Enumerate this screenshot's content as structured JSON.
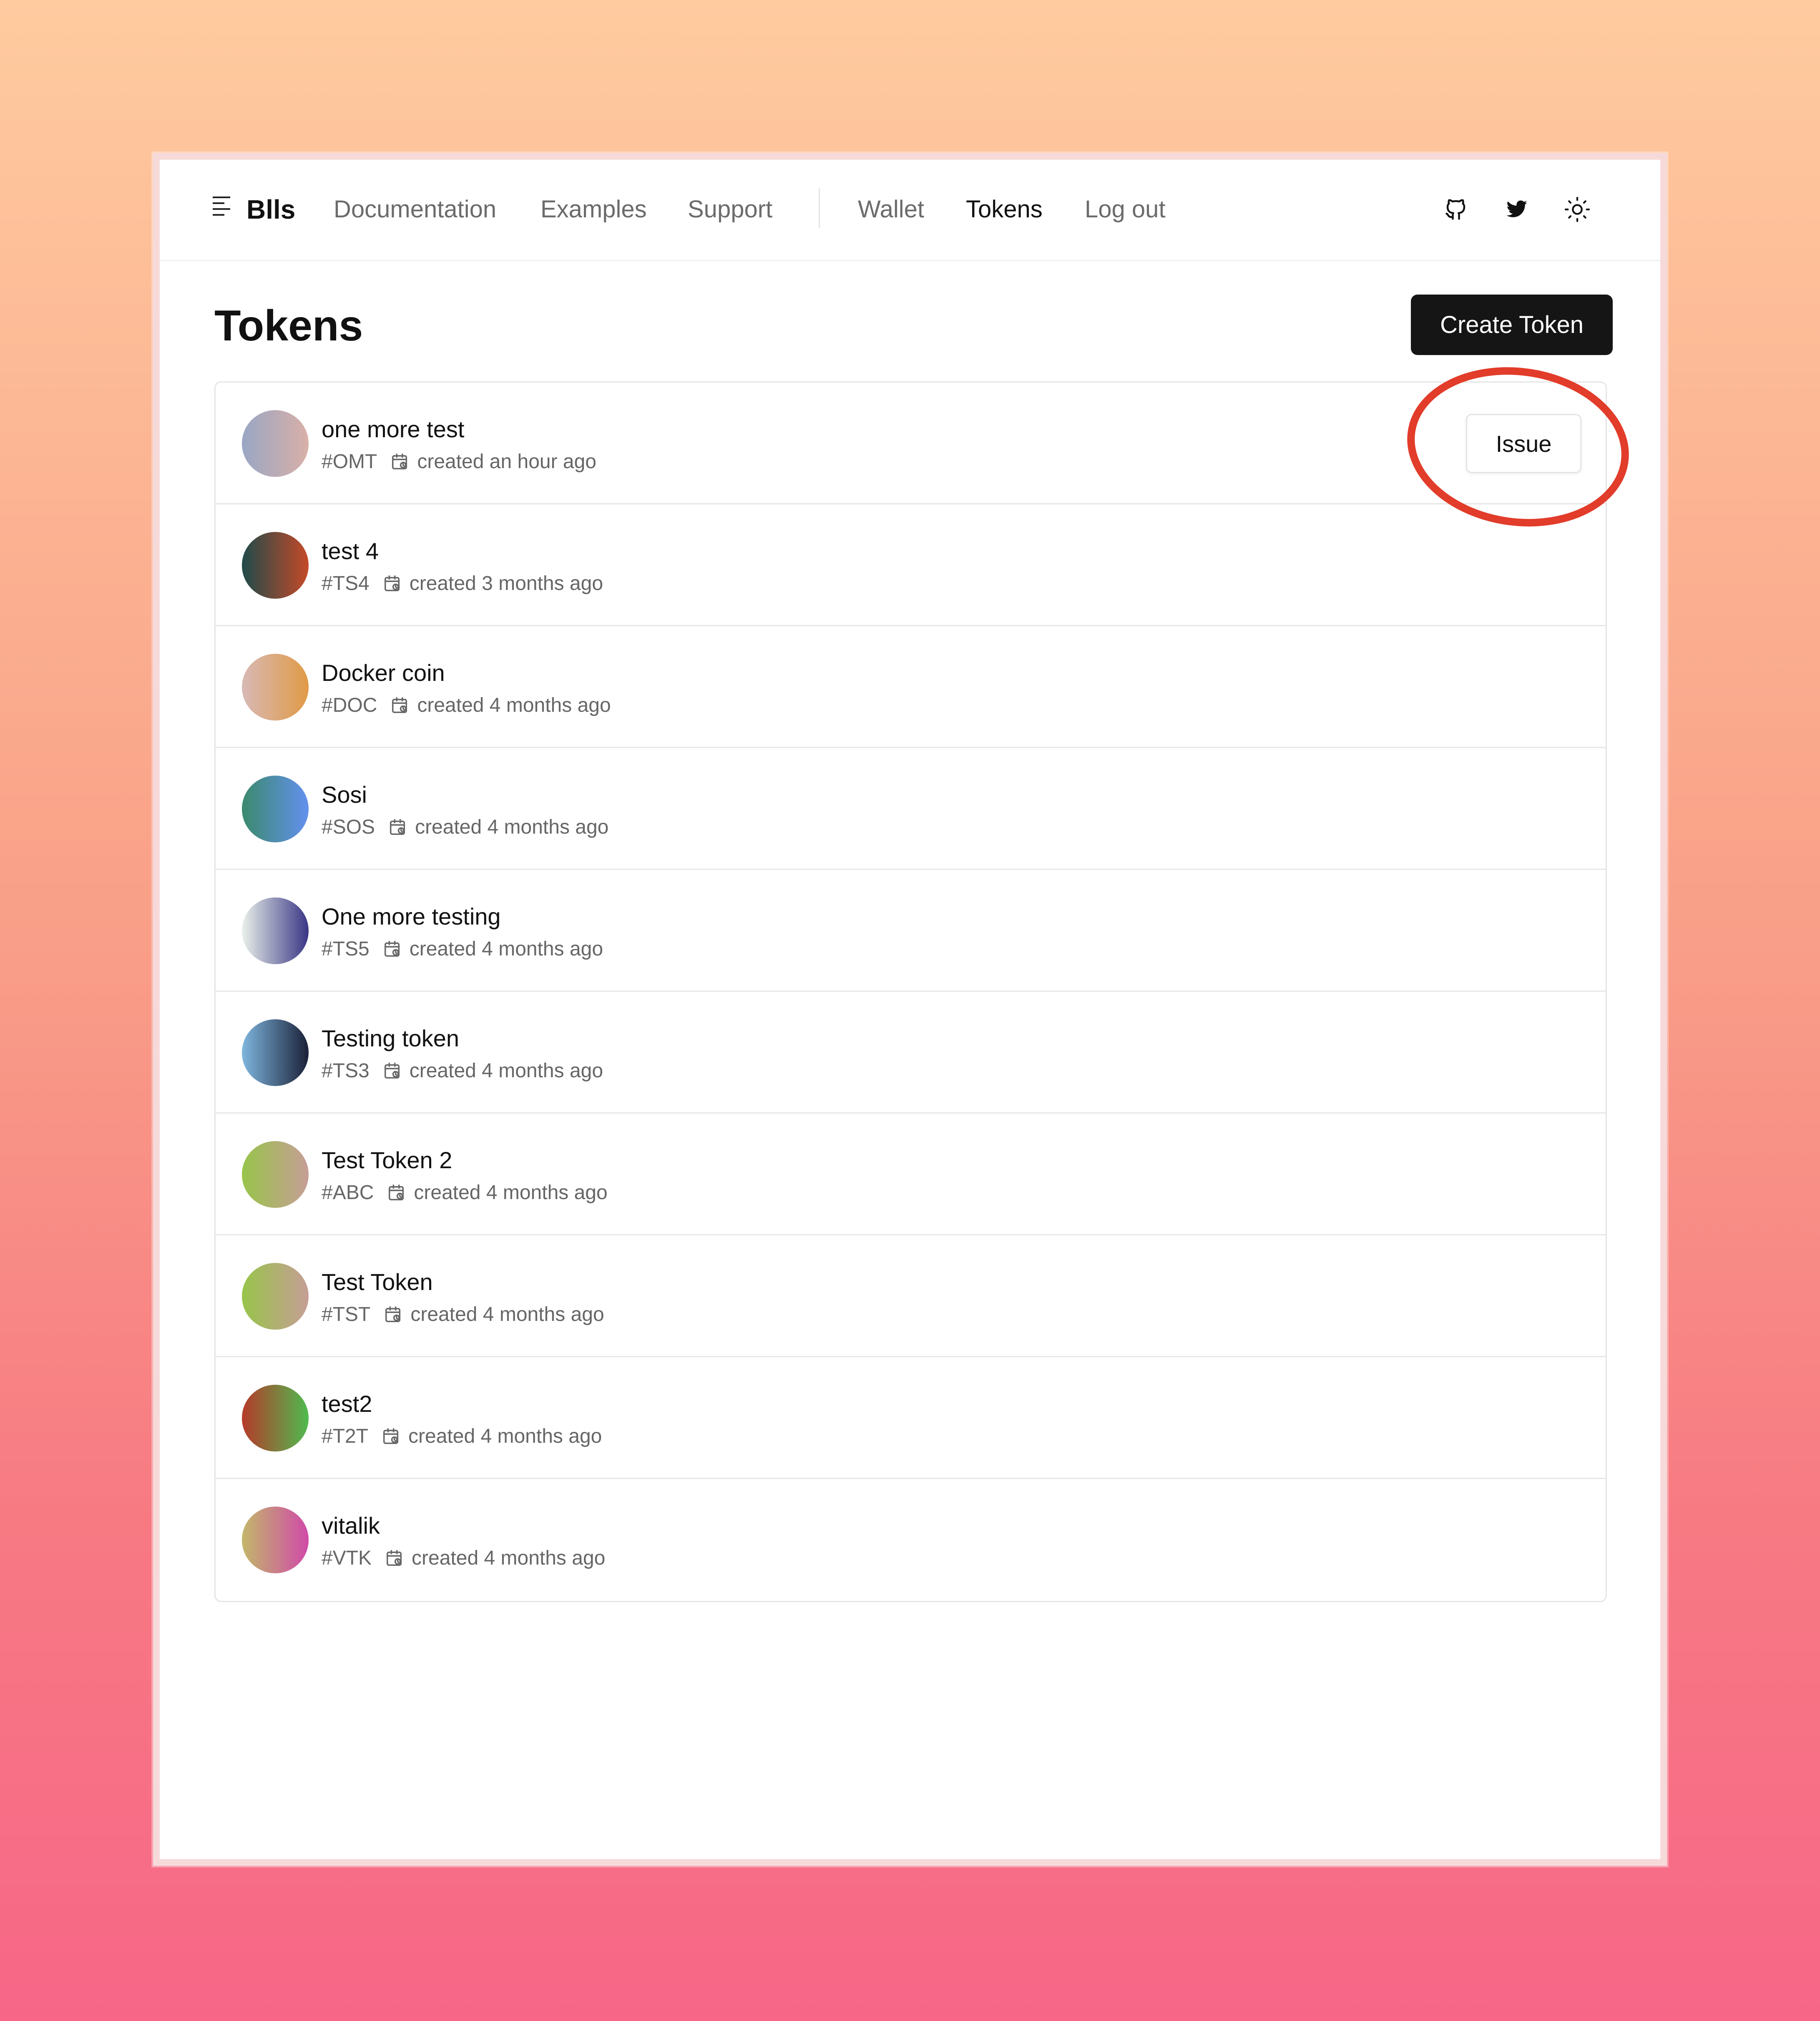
{
  "nav": {
    "brand": "Blls",
    "links": [
      {
        "label": "Documentation",
        "active": false
      },
      {
        "label": "Examples",
        "active": false
      },
      {
        "label": "Support",
        "active": false
      },
      {
        "label": "Wallet",
        "active": false
      },
      {
        "label": "Tokens",
        "active": true
      },
      {
        "label": "Log out",
        "active": false
      }
    ],
    "icons": [
      "github-icon",
      "twitter-icon",
      "sun-icon"
    ]
  },
  "page": {
    "title": "Tokens",
    "create_label": "Create Token"
  },
  "tokens": [
    {
      "name": "one more test",
      "symbol": "#OMT",
      "created": "created an hour ago",
      "action": "Issue",
      "colors": [
        "#99a6c4",
        "#d9b0a8"
      ]
    },
    {
      "name": "test 4",
      "symbol": "#TS4",
      "created": "created 3 months ago",
      "colors": [
        "#1f4a4a",
        "#c54a28"
      ]
    },
    {
      "name": "Docker coin",
      "symbol": "#DOC",
      "created": "created 4 months ago",
      "colors": [
        "#d8b9b6",
        "#e09a45"
      ]
    },
    {
      "name": "Sosi",
      "symbol": "#SOS",
      "created": "created 4 months ago",
      "colors": [
        "#3b8a6c",
        "#6390ef"
      ]
    },
    {
      "name": "One more testing",
      "symbol": "#TS5",
      "created": "created 4 months ago",
      "colors": [
        "#e9f1e9",
        "#3a3585"
      ]
    },
    {
      "name": "Testing token",
      "symbol": "#TS3",
      "created": "created 4 months ago",
      "colors": [
        "#7fb6de",
        "#1a2038"
      ]
    },
    {
      "name": "Test Token 2",
      "symbol": "#ABC",
      "created": "created 4 months ago",
      "colors": [
        "#98c44a",
        "#c69e96"
      ]
    },
    {
      "name": "Test Token",
      "symbol": "#TST",
      "created": "created 4 months ago",
      "colors": [
        "#98c44a",
        "#c69e96"
      ]
    },
    {
      "name": "test2",
      "symbol": "#T2T",
      "created": "created 4 months ago",
      "colors": [
        "#b53a2a",
        "#4fbb4f"
      ]
    },
    {
      "name": "vitalik",
      "symbol": "#VTK",
      "created": "created 4 months ago",
      "colors": [
        "#c2b76a",
        "#d04aa8"
      ]
    }
  ],
  "annotation_color": "#e23c2a"
}
